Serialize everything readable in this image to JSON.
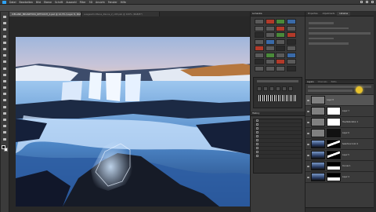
{
  "menu": {
    "items": [
      "Datei",
      "Bearbeiten",
      "Bild",
      "Ebene",
      "Schrift",
      "Auswahl",
      "Filter",
      "3D",
      "Ansicht",
      "Fenster",
      "Hilfe"
    ]
  },
  "document": {
    "tabs": [
      {
        "label": "ICELAND_BRUARFOSS_RETOUCH_2.psd @ 12,5% (Layer 8, RGB/16*)"
      },
      {
        "label": "ausgeschnittene_Zaune_2_v03.psb @ 100% (RGB/8*)"
      }
    ]
  },
  "panels": {
    "col1_title": "Lumenzia",
    "properties_tabs": [
      "Properties",
      "Adjustments",
      "Libraries"
    ],
    "properties_title": "Properties",
    "layers_tabs": [
      "Layers",
      "Channels",
      "Paths"
    ],
    "history_title": "History"
  },
  "layers": [
    {
      "name": "Layer 8",
      "thumb": "gray",
      "mask": ""
    },
    {
      "name": "Layer 7",
      "thumb": "gray",
      "mask": "white"
    },
    {
      "name": "Hue/Saturation 1",
      "thumb": "gray",
      "mask": "white"
    },
    {
      "name": "Layer 6",
      "thumb": "gray",
      "mask": "black"
    },
    {
      "name": "Selective Color 2",
      "thumb": "photo",
      "mask": "mtn"
    },
    {
      "name": "Layer 5",
      "thumb": "photo",
      "mask": "mtn"
    },
    {
      "name": "Curves 1",
      "thumb": "photo",
      "mask": "peak"
    },
    {
      "name": "Layer 4",
      "thumb": "photo",
      "mask": "peak"
    }
  ],
  "colors": {
    "foreground": "#111111",
    "background": "#ffffff",
    "accent": "#e8c22c"
  }
}
